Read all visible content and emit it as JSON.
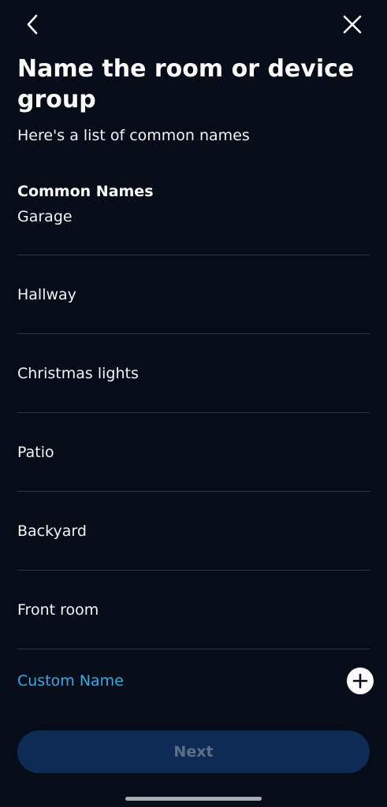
{
  "header": {
    "back_icon": "chevron-left-icon",
    "close_icon": "close-icon"
  },
  "title": "Name the room or device group",
  "subtitle": "Here's a list of common names",
  "section_header": "Common Names",
  "common_names": [
    "Garage",
    "Hallway",
    "Christmas lights",
    "Patio",
    "Backyard",
    "Front room"
  ],
  "custom": {
    "label": "Custom Name",
    "icon": "plus-circle-icon"
  },
  "next_label": "Next",
  "colors": {
    "background": "#050d18",
    "accent": "#3aa9e6",
    "divider": "#2b3440",
    "button_bg": "#0d2b55",
    "button_text_disabled": "#5e6f86"
  }
}
